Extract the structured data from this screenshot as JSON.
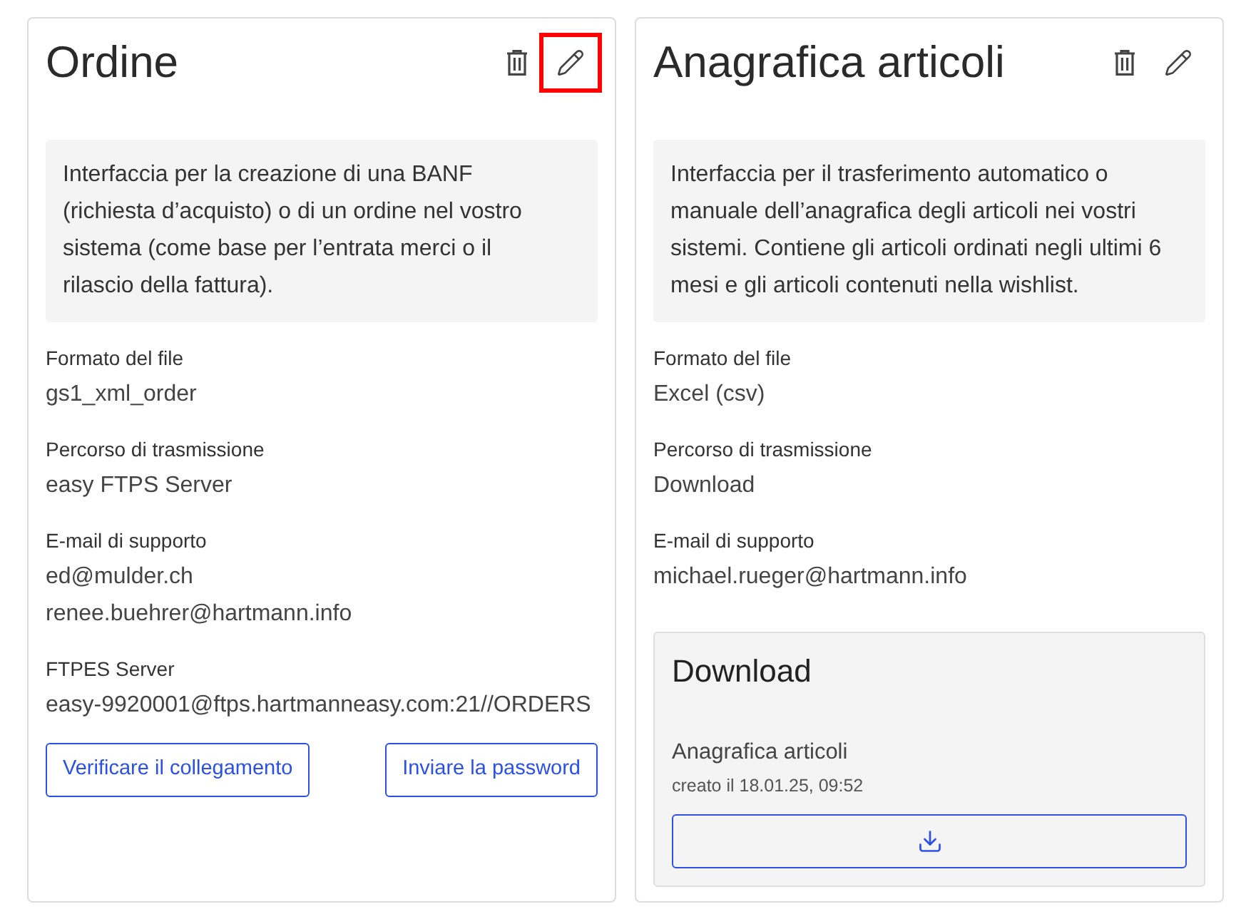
{
  "cards": [
    {
      "title": "Ordine",
      "actions": [
        {
          "kind": "delete",
          "highlighted": false
        },
        {
          "kind": "edit",
          "highlighted": true
        }
      ],
      "description": "Interfaccia per la creazione di una BANF (richiesta d’acquisto) o di un ordine nel vostro sistema (come base per l’entrata merci o il rilascio della fattura).",
      "fields": [
        {
          "label": "Formato del file",
          "values": [
            "gs1_xml_order"
          ]
        },
        {
          "label": "Percorso di trasmissione",
          "values": [
            "easy FTPS Server"
          ]
        },
        {
          "label": "E-mail di supporto",
          "values": [
            "ed@mulder.ch",
            "renee.buehrer@hartmann.info"
          ]
        },
        {
          "label": "FTPES Server",
          "values": [
            "easy-9920001@ftps.hartmanneasy.com:21//ORDERS"
          ]
        }
      ],
      "buttons": [
        "Verificare il collegamento",
        "Inviare la password"
      ]
    },
    {
      "title": "Anagrafica articoli",
      "actions": [
        {
          "kind": "delete",
          "highlighted": false
        },
        {
          "kind": "edit",
          "highlighted": false
        }
      ],
      "description": "Interfaccia per il trasferimento automatico o manuale dell’anagrafica degli articoli nei vostri sistemi. Contiene gli articoli ordinati negli ultimi 6 mesi e gli articoli contenuti nella wishlist.",
      "fields": [
        {
          "label": "Formato del file",
          "values": [
            "Excel (csv)"
          ]
        },
        {
          "label": "Percorso di trasmissione",
          "values": [
            "Download"
          ]
        },
        {
          "label": "E-mail di supporto",
          "values": [
            "michael.rueger@hartmann.info"
          ]
        }
      ],
      "download": {
        "title": "Download",
        "file_name": "Anagrafica articoli",
        "created": "creato il 18.01.25, 09:52"
      }
    }
  ]
}
